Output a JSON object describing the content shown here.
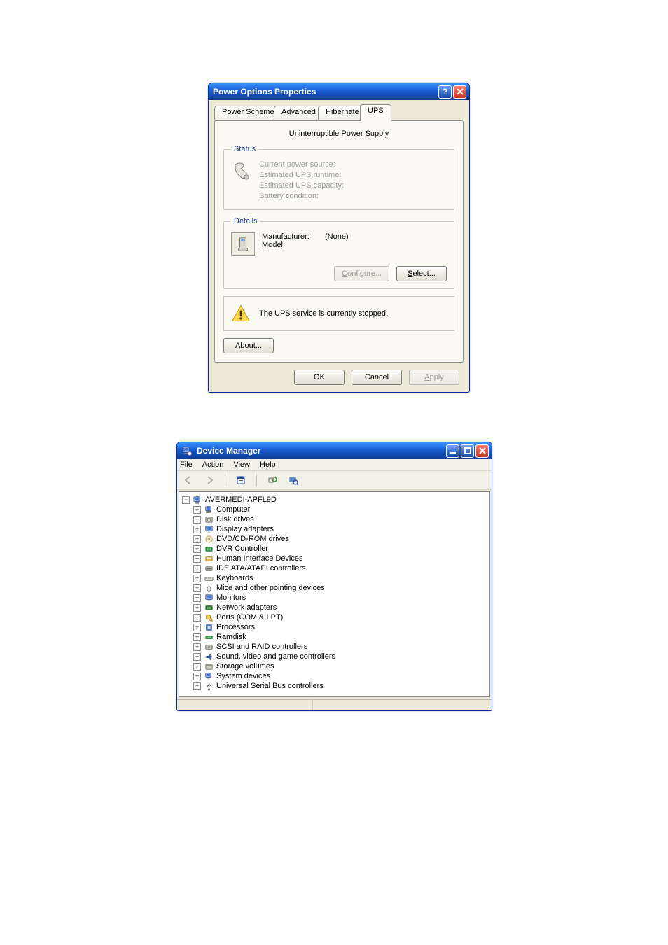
{
  "dialog1": {
    "title": "Power Options Properties",
    "tabs": [
      {
        "label": "Power Schemes"
      },
      {
        "label": "Advanced"
      },
      {
        "label": "Hibernate"
      },
      {
        "label": "UPS"
      }
    ],
    "active_tab_index": 3,
    "section_heading": "Uninterruptible Power Supply",
    "group_status": {
      "legend": "Status",
      "line1": "Current power source:",
      "line2": "Estimated UPS runtime:",
      "line3": "Estimated UPS capacity:",
      "line4": "Battery condition:"
    },
    "group_details": {
      "legend": "Details",
      "manufacturer_label": "Manufacturer:",
      "manufacturer_value": "(None)",
      "model_label": "Model:",
      "configure_text_pre": "C",
      "configure_text_post": "onfigure...",
      "select_text_pre": "S",
      "select_text_post": "elect..."
    },
    "warning_text": "The UPS service is currently stopped.",
    "about_pre": "A",
    "about_post": "bout...",
    "ok_label": "OK",
    "cancel_label": "Cancel",
    "apply_pre": "A",
    "apply_post": "pply"
  },
  "dialog2": {
    "title": "Device Manager",
    "menus": [
      {
        "pre": "F",
        "post": "ile"
      },
      {
        "pre": "A",
        "post": "ction"
      },
      {
        "pre": "V",
        "post": "iew"
      },
      {
        "pre": "H",
        "post": "elp"
      }
    ],
    "tree_root": "AVERMEDI-APFL9D",
    "tree": [
      {
        "label": "Computer",
        "icon": "computer"
      },
      {
        "label": "Disk drives",
        "icon": "disk"
      },
      {
        "label": "Display adapters",
        "icon": "display"
      },
      {
        "label": "DVD/CD-ROM drives",
        "icon": "cd"
      },
      {
        "label": "DVR Controller",
        "icon": "dvr"
      },
      {
        "label": "Human Interface Devices",
        "icon": "hid"
      },
      {
        "label": "IDE ATA/ATAPI controllers",
        "icon": "ide"
      },
      {
        "label": "Keyboards",
        "icon": "keyboard"
      },
      {
        "label": "Mice and other pointing devices",
        "icon": "mouse"
      },
      {
        "label": "Monitors",
        "icon": "monitor"
      },
      {
        "label": "Network adapters",
        "icon": "network"
      },
      {
        "label": "Ports (COM & LPT)",
        "icon": "port"
      },
      {
        "label": "Processors",
        "icon": "cpu"
      },
      {
        "label": "Ramdisk",
        "icon": "ram"
      },
      {
        "label": "SCSI and RAID controllers",
        "icon": "scsi"
      },
      {
        "label": "Sound, video and game controllers",
        "icon": "sound"
      },
      {
        "label": "Storage volumes",
        "icon": "storage"
      },
      {
        "label": "System devices",
        "icon": "system"
      },
      {
        "label": "Universal Serial Bus controllers",
        "icon": "usb"
      }
    ]
  }
}
